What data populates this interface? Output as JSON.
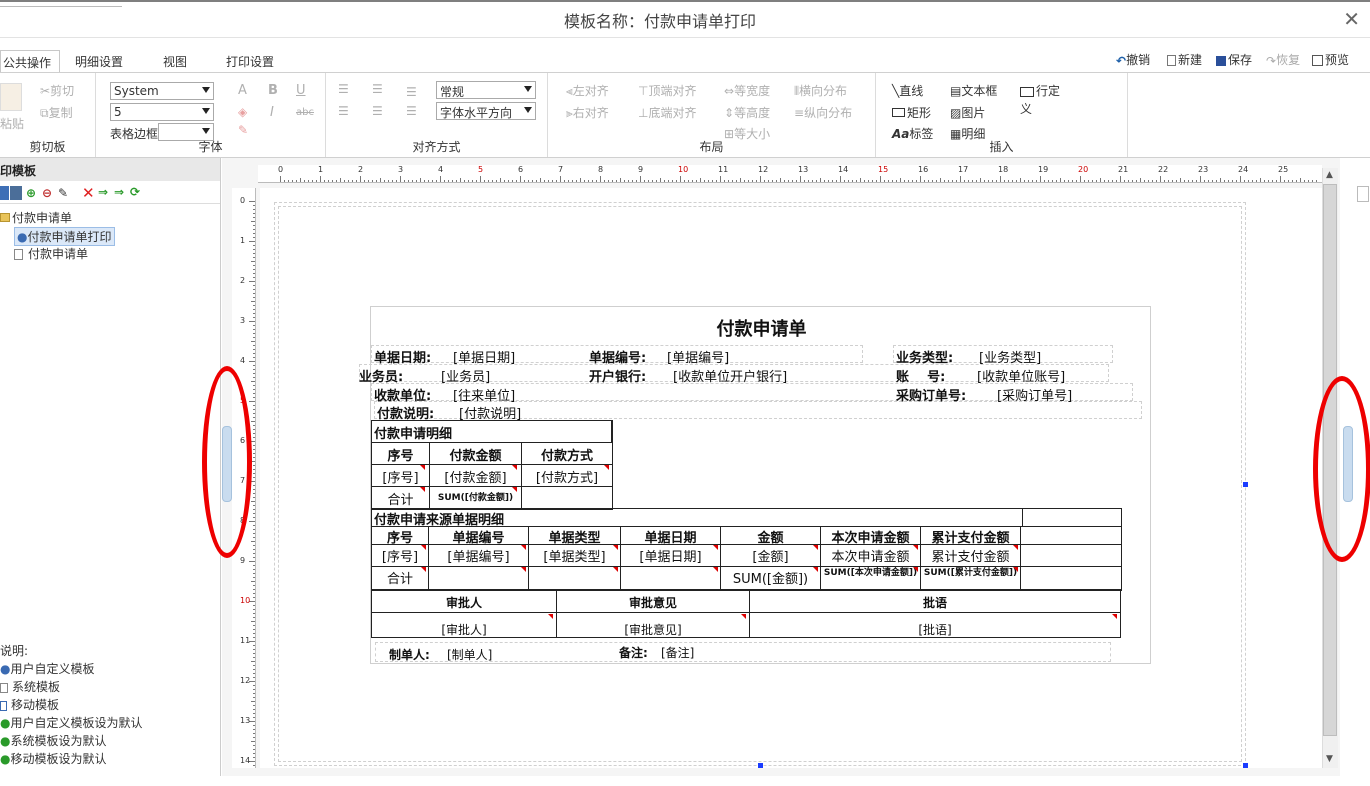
{
  "window": {
    "title": "模板名称：付款申请单打印"
  },
  "tabs": [
    {
      "label": "公共操作"
    },
    {
      "label": "明细设置"
    },
    {
      "label": "视图"
    },
    {
      "label": "打印设置"
    }
  ],
  "quick_actions": {
    "undo": "撤销",
    "new": "新建",
    "save": "保存",
    "redo": "恢复",
    "preview": "预览"
  },
  "ribbon": {
    "clipboard": {
      "group": "剪切板",
      "paste": "粘贴",
      "cut": "剪切",
      "copy": "复制"
    },
    "font": {
      "group": "字体",
      "font_name": "System",
      "font_size": "5",
      "border_label": "表格边框",
      "border_value": "",
      "bold": "B",
      "italic": "I",
      "underline": "U",
      "strike": "abc"
    },
    "align": {
      "group": "对齐方式",
      "style_value": "常规",
      "halign_value": "字体水平方向"
    },
    "layout": {
      "group": "布局",
      "left": "左对齐",
      "right": "右对齐",
      "top": "顶端对齐",
      "bottom": "底端对齐",
      "same_width": "等宽度",
      "same_height": "等高度",
      "same_size": "等大小",
      "hdist": "横向分布",
      "vdist": "纵向分布"
    },
    "insert": {
      "group": "插入",
      "line": "直线",
      "rect": "矩形",
      "label": "标签",
      "textbox": "文本框",
      "image": "图片",
      "detail": "明细",
      "custom_row": "行定义"
    }
  },
  "left_panel": {
    "header": "印模板",
    "tree": {
      "root": "付款申请单",
      "child_selected": "付款申请单打印",
      "child2": "付款申请单"
    },
    "legend_title": "说明:",
    "legend": [
      "用户自定义模板",
      "系统模板",
      "移动模板",
      "用户自定义模板设为默认",
      "系统模板设为默认",
      "移动模板设为默认"
    ]
  },
  "ruler": {
    "h": [
      "0",
      "1",
      "2",
      "3",
      "4",
      "5",
      "6",
      "7",
      "8",
      "9",
      "10",
      "11",
      "12",
      "13",
      "14",
      "15",
      "16",
      "17",
      "18",
      "19",
      "20",
      "21",
      "22",
      "23",
      "24",
      "25"
    ],
    "v": [
      "0",
      "1",
      "2",
      "3",
      "4",
      "5",
      "6",
      "7",
      "8",
      "9",
      "10",
      "11",
      "12",
      "13",
      "14"
    ]
  },
  "report": {
    "title": "付款申请单",
    "f1l": "单据日期:",
    "f1v": "[单据日期]",
    "f2l": "单据编号:",
    "f2v": "[单据编号]",
    "f3l": "业务类型:",
    "f3v": "[业务类型]",
    "f4l": "业务员:",
    "f4v": "[业务员]",
    "f5l": "开户银行:",
    "f5v": "[收款单位开户银行]",
    "f6l": "账    号:",
    "f6v": "[收款单位账号]",
    "f7l": "收款单位:",
    "f7v": "[往来单位]",
    "f8l": "采购订单号:",
    "f8v": "[采购订单号]",
    "f9l": "付款说明:",
    "f9v": "[付款说明]",
    "d1": {
      "title": "付款申请明细",
      "h": [
        "序号",
        "付款金额",
        "付款方式"
      ],
      "r": [
        "[序号]",
        "[付款金额]",
        "[付款方式]"
      ],
      "t": [
        "合计",
        "SUM([付款金额])",
        ""
      ]
    },
    "d2": {
      "title": "付款申请来源单据明细",
      "h": [
        "序号",
        "单据编号",
        "单据类型",
        "单据日期",
        "金额",
        "本次申请金额",
        "累计支付金额"
      ],
      "r": [
        "[序号]",
        "[单据编号]",
        "[单据类型]",
        "[单据日期]",
        "[金额]",
        "本次申请金额",
        "累计支付金额"
      ],
      "t": [
        "合计",
        "",
        "",
        "",
        "SUM([金额])",
        "SUM([本次申请金额])",
        "SUM([累计支付金额])"
      ]
    },
    "d3": {
      "h": [
        "审批人",
        "审批意见",
        "批语"
      ],
      "r": [
        "[审批人]",
        "[审批意见]",
        "[批语]"
      ]
    },
    "maker_l": "制单人:",
    "maker_v": "[制单人]",
    "remark_l": "备注:",
    "remark_v": "[备注]"
  }
}
